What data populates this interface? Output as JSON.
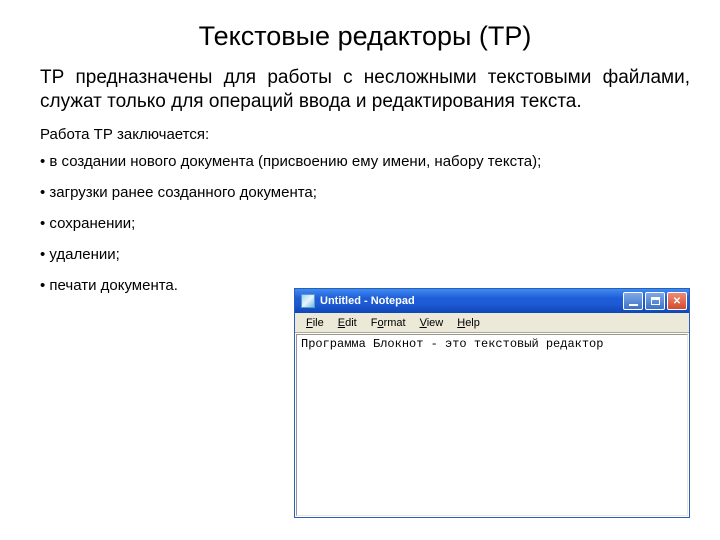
{
  "title": "Текстовые редакторы (ТР)",
  "intro": "ТР предназначены для работы с несложными текстовыми файлами, служат только для операций ввода и редактирования текста.",
  "subhead": "Работа ТР заключается:",
  "bullets": [
    "в создании нового документа (присвоению ему имени, набору текста);",
    "загрузки ранее созданного документа;",
    "сохранении;",
    "удалении;",
    "печати документа."
  ],
  "notepad": {
    "title": "Untitled - Notepad",
    "menu": {
      "file": {
        "u": "F",
        "rest": "ile"
      },
      "edit": {
        "u": "E",
        "rest": "dit"
      },
      "format": {
        "pre": "F",
        "u": "o",
        "rest": "rmat"
      },
      "view": {
        "u": "V",
        "rest": "iew"
      },
      "help": {
        "u": "H",
        "rest": "elp"
      }
    },
    "content": "Программа Блокнот - это текстовый редактор"
  }
}
